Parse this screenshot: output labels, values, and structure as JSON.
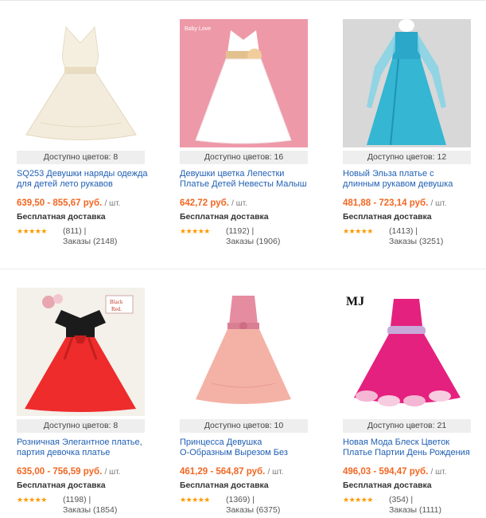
{
  "products": [
    {
      "colors_available": "Доступно цветов: 8",
      "title_line1": "SQ253 Девушки наряды одежда",
      "title_line2": "для детей лето рукавов",
      "price": "639,50 - 855,67 руб.",
      "unit": "/ шт.",
      "shipping": "Бесплатная доставка",
      "stars": "★★★★★",
      "reviews": "(811)  |",
      "orders": "Заказы (2148)",
      "dress_color": "#f3ecdc"
    },
    {
      "colors_available": "Доступно цветов: 16",
      "title_line1": "Девушки цветка Лепестки",
      "title_line2": "Платье Детей Невесты Малыш",
      "price": "642,72 руб.",
      "unit": "/ шт.",
      "shipping": "Бесплатная доставка",
      "stars": "★★★★★",
      "reviews": "(1192)  |",
      "orders": "Заказы (1906)",
      "dress_color": "#ffffff"
    },
    {
      "colors_available": "Доступно цветов: 12",
      "title_line1": "Новый Эльза платье с",
      "title_line2": "длинным рукавом девушка",
      "price": "481,88 - 723,14 руб.",
      "unit": "/ шт.",
      "shipping": "Бесплатная доставка",
      "stars": "★★★★★",
      "reviews": "(1413)  |",
      "orders": "Заказы (3251)",
      "dress_color": "#35b6d3"
    },
    {
      "colors_available": "Доступно цветов: 8",
      "title_line1": "Розничная Элегантное платье,",
      "title_line2": "партия девочка платье",
      "price": "635,00 - 756,59 руб.",
      "unit": "/ шт.",
      "shipping": "Бесплатная доставка",
      "stars": "★★★★★",
      "reviews": "(1198)  |",
      "orders": "Заказы (1854)",
      "dress_color": "#ee2c2c",
      "sign_text_1": "Black",
      "sign_text_2": "Red."
    },
    {
      "colors_available": "Доступно цветов: 10",
      "title_line1": "Принцесса Девушка",
      "title_line2": "О-Образным Вырезом Без",
      "price": "461,29 - 564,87 руб.",
      "unit": "/ шт.",
      "shipping": "Бесплатная доставка",
      "stars": "★★★★★",
      "reviews": "(1369)  |",
      "orders": "Заказы (6375)",
      "dress_color": "#f4b2a6"
    },
    {
      "colors_available": "Доступно цветов: 21",
      "title_line1": "Новая Мода Блеск Цветок",
      "title_line2": "Платье Партии День Рождения",
      "price": "496,03 - 594,47 руб.",
      "unit": "/ шт.",
      "shipping": "Бесплатная доставка",
      "stars": "★★★★★",
      "reviews": "(354)  |",
      "orders": "Заказы (1111)",
      "dress_color": "#e5217f",
      "logo_text": "MJ"
    }
  ]
}
